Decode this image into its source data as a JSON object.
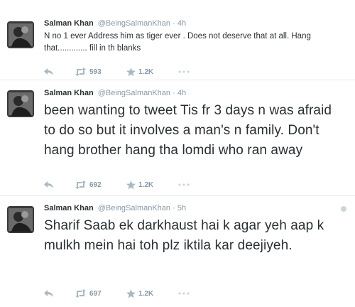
{
  "tweets": [
    {
      "name": "Salman Khan",
      "handle": "@BeingSalmanKhan",
      "separator": "·",
      "time": "4h",
      "text": "N no 1 ever Address him as tiger ever . Does not deserve that at all. Hang that............. fill in th blanks",
      "retweets": "593",
      "favorites": "1.2K"
    },
    {
      "name": "Salman Khan",
      "handle": "@BeingSalmanKhan",
      "separator": "·",
      "time": "4h",
      "text": "been wanting to tweet Tis fr 3 days n was afraid to do so but it involves a man's n family. Don't hang brother hang tha lomdi who ran away",
      "retweets": "692",
      "favorites": "1.2K"
    },
    {
      "name": "Salman Khan",
      "handle": "@BeingSalmanKhan",
      "separator": "·",
      "time": "5h",
      "text": "Sharif Saab ek darkhaust hai k agar yeh aap k mulkh mein hai toh plz iktila kar deejiyeh.",
      "retweets": "697",
      "favorites": "1.2K"
    }
  ],
  "icons": {
    "reply": "reply-icon",
    "retweet": "retweet-icon",
    "favorite": "star-icon",
    "more": "more-dots-icon",
    "caret": "dropdown-caret-icon"
  },
  "colors": {
    "icon": "#8899a6",
    "text": "#292f33",
    "divider": "#e6ecf0"
  }
}
